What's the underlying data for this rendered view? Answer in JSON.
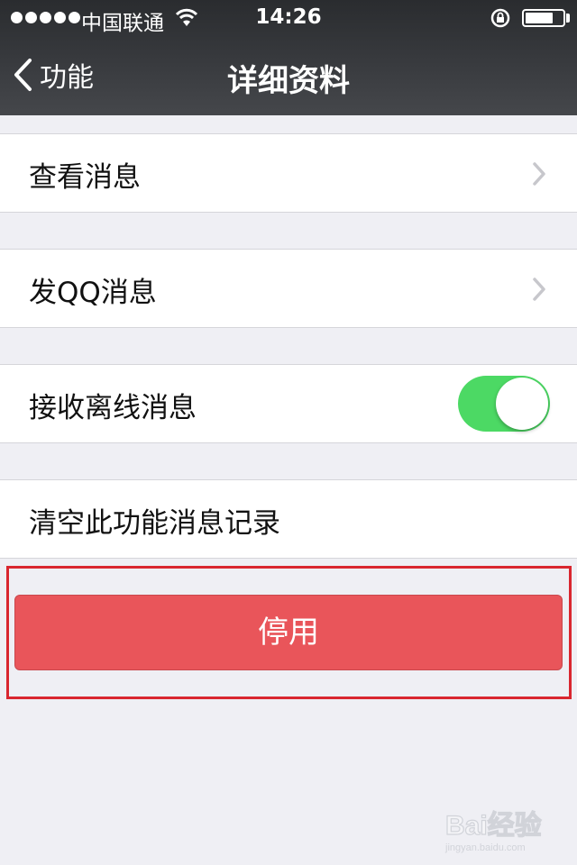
{
  "status_bar": {
    "carrier": "中国联通",
    "time": "14:26",
    "battery_level": 0.75
  },
  "nav": {
    "back_label": "功能",
    "title": "详细资料"
  },
  "rows": [
    {
      "label": "查看消息"
    },
    {
      "label": "发QQ消息"
    },
    {
      "label": "接收离线消息",
      "toggle_on": true
    },
    {
      "label": "清空此功能消息记录"
    }
  ],
  "disable_button": {
    "label": "停用"
  },
  "colors": {
    "accent_green": "#4cd964",
    "danger_red": "#e9555a",
    "highlight_red": "#d9262f",
    "background": "#efeff4"
  },
  "watermark": {
    "text": "Bai经验",
    "sub": "jingyan.baidu.com"
  }
}
